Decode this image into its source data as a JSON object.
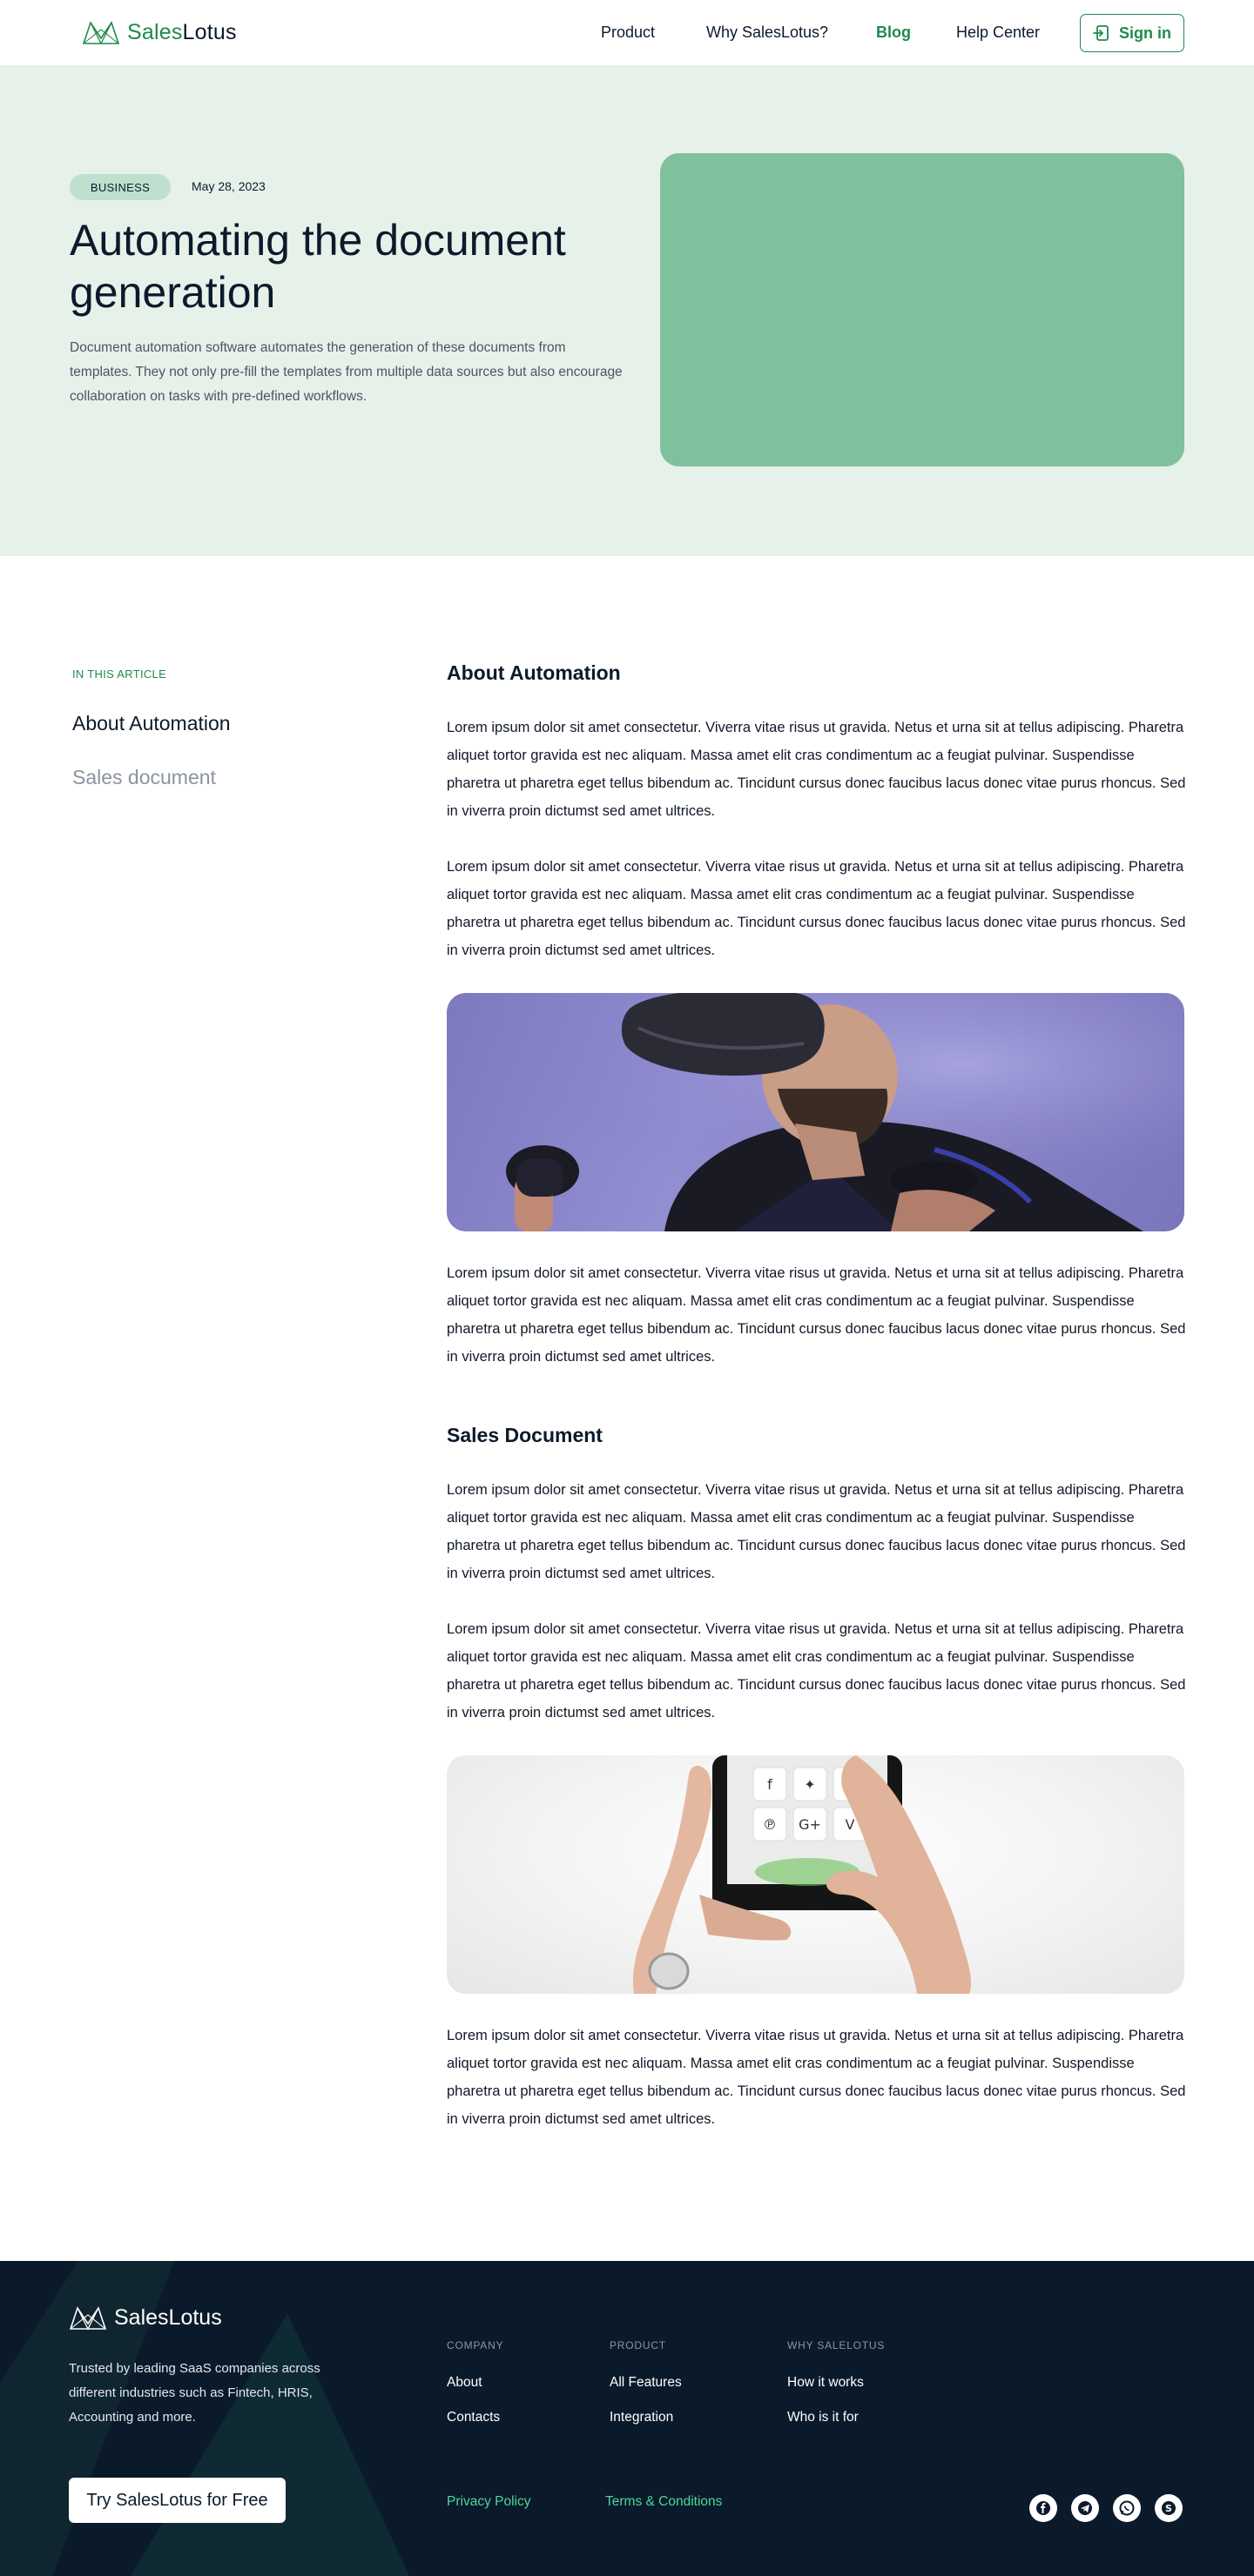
{
  "header": {
    "brand_part1": "Sales",
    "brand_part2": "Lotus",
    "nav": [
      "Product",
      "Why SalesLotus?",
      "Blog",
      "Help Center"
    ],
    "signin_label": "Sign in"
  },
  "hero": {
    "tag": "BUSINESS",
    "date": "May 28, 2023",
    "title": "Automating the document generation",
    "description": "Document automation software automates the generation of these documents from templates. They not only pre-fill the templates from multiple data sources but also encourage collaboration on tasks with pre-defined workflows."
  },
  "toc": {
    "label": "IN THIS ARTICLE",
    "items": [
      "About Automation",
      "Sales document"
    ]
  },
  "article": {
    "section1_title": "About Automation",
    "section2_title": "Sales Document",
    "paragraph": "Lorem ipsum dolor sit amet consectetur. Viverra vitae risus ut gravida. Netus et urna sit at tellus adipiscing. Pharetra aliquet tortor gravida est nec aliquam. Massa amet elit cras condimentum ac a feugiat pulvinar. Suspendisse pharetra ut pharetra eget tellus bibendum ac. Tincidunt cursus donec faucibus lacus donec vitae purus rhoncus. Sed in viverra proin dictumst sed amet ultrices."
  },
  "footer": {
    "brand": "SalesLotus",
    "description": "Trusted by leading SaaS companies across different industries such as Fintech, HRIS, Accounting and more.",
    "cta": "Try SalesLotus for Free",
    "columns": [
      {
        "heading": "COMPANY",
        "links": [
          "About",
          "Contacts"
        ]
      },
      {
        "heading": "PRODUCT",
        "links": [
          "All Features",
          "Integration"
        ]
      },
      {
        "heading": "WHY SALELOTUS",
        "links": [
          "How it works",
          "Who is it for"
        ]
      }
    ],
    "legal": [
      "Privacy Policy",
      "Terms & Conditions"
    ],
    "social_icons": [
      "facebook-icon",
      "telegram-icon",
      "whatsapp-icon",
      "skype-icon"
    ]
  },
  "colors": {
    "brand_green": "#1f8a4c",
    "hero_bg": "#e6f1ea",
    "hero_image": "#81c09c",
    "footer_bg": "#0b1a2b",
    "footer_link_accent": "#4ed69a"
  }
}
